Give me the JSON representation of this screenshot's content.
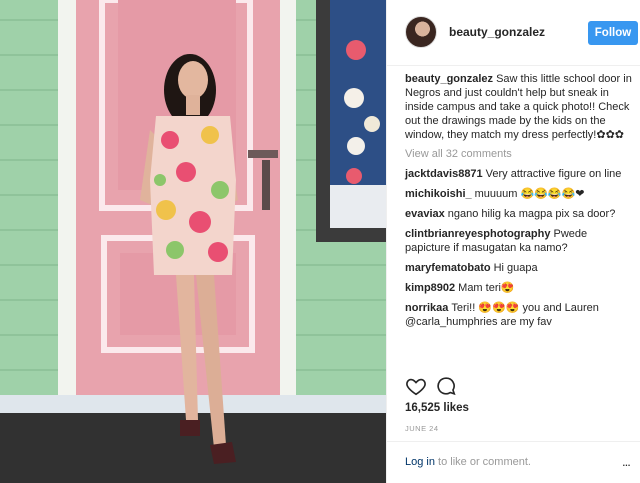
{
  "post": {
    "username": "beauty_gonzalez",
    "follow_label": "Follow",
    "caption_user": "beauty_gonzalez",
    "caption_text": "Saw this little school door in Negros and just couldn't help but sneak in inside campus and take a quick photo!! Check out the drawings made by the kids on the window, they match my dress perfectly!✿✿✿",
    "view_all": "View all 32 comments",
    "comments": [
      {
        "user": "jacktdavis8871",
        "text": "Very attractive figure on line"
      },
      {
        "user": "michikoishi_",
        "text": "muuuum 😂😂😂😂❤"
      },
      {
        "user": "evaviax",
        "text": "ngano hilig ka magpa pix sa door?"
      },
      {
        "user": "clintbrianreyesphotography",
        "text": "Pwede papicture if masugatan ka namo?"
      },
      {
        "user": "maryfematobato",
        "text": "Hi guapa"
      },
      {
        "user": "kimp8902",
        "text": "Mam teri😍"
      },
      {
        "user": "norrikaa",
        "text": "Teri!! 😍😍😍 you and Lauren @carla_humphries are my fav"
      }
    ],
    "likes": "16,525 likes",
    "date": "JUNE 24",
    "login_link": "Log in",
    "login_rest": "to like or comment.",
    "more_label": "..."
  },
  "colors": {
    "follow_bg": "#3897f0",
    "muted": "#999999",
    "link": "#003569",
    "door_pink": "#e8a3ad",
    "wall_green": "#9fd1a9"
  },
  "icons": [
    "heart-icon",
    "comment-icon",
    "more-options-icon"
  ]
}
